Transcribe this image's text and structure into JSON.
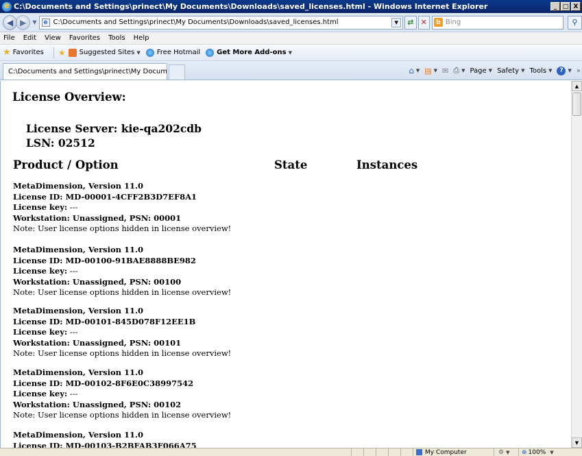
{
  "window": {
    "title": "C:\\Documents and Settings\\prinect\\My Documents\\Downloads\\saved_licenses.html - Windows Internet Explorer",
    "min": "_",
    "max": "□",
    "close": "X"
  },
  "address": {
    "url": "C:\\Documents and Settings\\prinect\\My Documents\\Downloads\\saved_licenses.html",
    "search_placeholder": "Bing"
  },
  "menu": [
    "File",
    "Edit",
    "View",
    "Favorites",
    "Tools",
    "Help"
  ],
  "favorites": {
    "label": "Favorites",
    "items": [
      "Suggested Sites",
      "Free Hotmail",
      "Get More Add-ons"
    ]
  },
  "tab": {
    "label": "C:\\Documents and Settings\\prinect\\My Documents\\Do..."
  },
  "commands": [
    "Page",
    "Safety",
    "Tools"
  ],
  "page": {
    "overview_heading": "License Overview:",
    "server_line": "License Server: kie-qa202cdb",
    "lsn_line": "LSN: 02512",
    "columns": {
      "product": "Product / Option",
      "state": "State",
      "instances": "Instances"
    },
    "licenses": [
      {
        "product": "MetaDimension, Version 11.0",
        "license_id": "License ID: MD-00001-4CFF2B3D7EF8A1",
        "license_key_label": "License key:",
        "license_key_value": " ---",
        "workstation": "Workstation:  Unassigned,  PSN: 00001",
        "note": "Note: User license options hidden in license overview!"
      },
      {
        "product": "MetaDimension, Version 11.0",
        "license_id": "License ID: MD-00100-91BAE8888BE982",
        "license_key_label": "License key:",
        "license_key_value": " ---",
        "workstation": "Workstation:  Unassigned,  PSN: 00100",
        "note": "Note: User license options hidden in license overview!"
      },
      {
        "product": "MetaDimension, Version 11.0",
        "license_id": "License ID: MD-00101-845D078F12EE1B",
        "license_key_label": "License key:",
        "license_key_value": " ---",
        "workstation": "Workstation:  Unassigned,  PSN: 00101",
        "note": "Note: User license options hidden in license overview!"
      },
      {
        "product": "MetaDimension, Version 11.0",
        "license_id": "License ID: MD-00102-8F6E0C38997542",
        "license_key_label": "License key:",
        "license_key_value": " ---",
        "workstation": "Workstation:  Unassigned,  PSN: 00102",
        "note": "Note: User license options hidden in license overview!"
      },
      {
        "product": "MetaDimension, Version 11.0",
        "license_id": "License ID: MD-00103-B2BFAB3F066A75",
        "license_key_label": "",
        "license_key_value": "",
        "workstation": "",
        "note": ""
      }
    ]
  },
  "status": {
    "zone": "My Computer",
    "zoom": "100%"
  }
}
